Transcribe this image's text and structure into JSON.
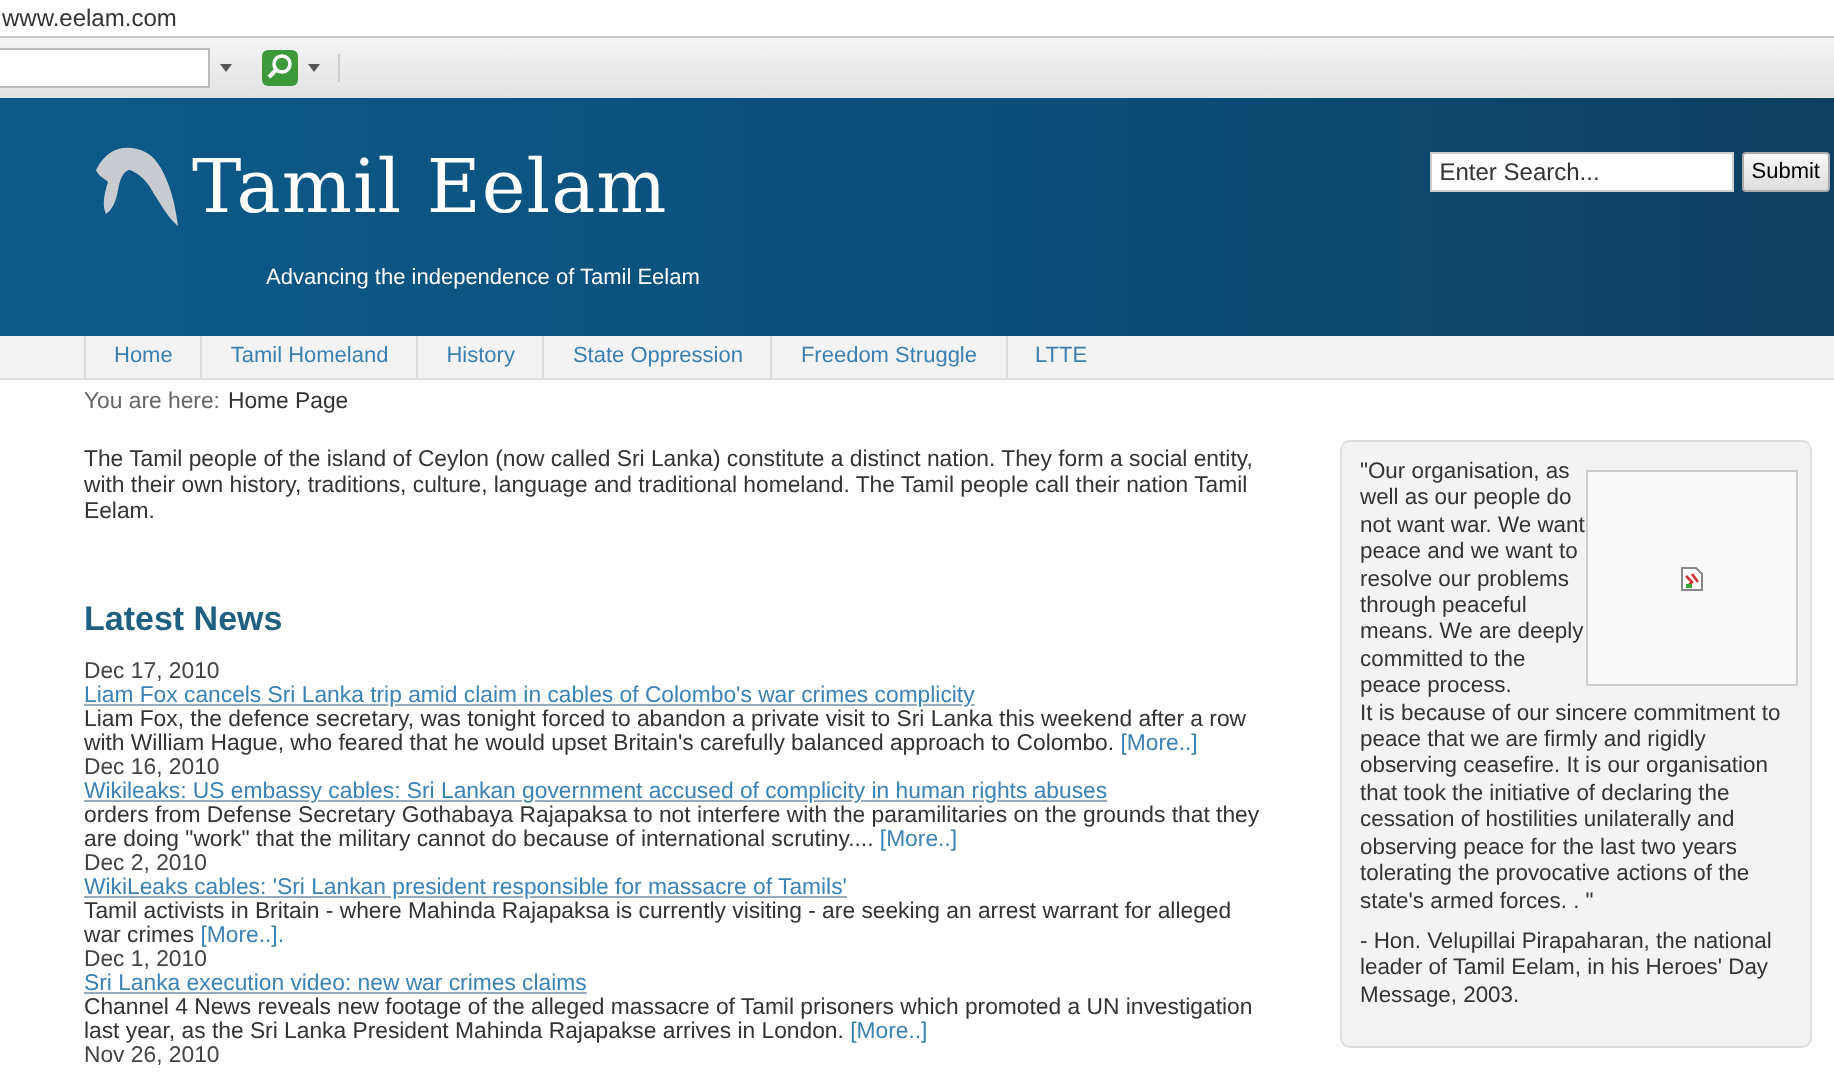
{
  "address": "www.eelam.com",
  "header": {
    "title": "Tamil Eelam",
    "tagline": "Advancing the independence of Tamil Eelam",
    "search": {
      "placeholder": "Enter Search..."
    },
    "submit": "Submit"
  },
  "nav": [
    {
      "label": "Home"
    },
    {
      "label": "Tamil Homeland"
    },
    {
      "label": "History"
    },
    {
      "label": "State Oppression"
    },
    {
      "label": "Freedom Struggle"
    },
    {
      "label": "LTTE"
    }
  ],
  "breadcrumb": {
    "label": "You are here:",
    "page": "Home Page"
  },
  "intro": "The Tamil people of the island of Ceylon (now called Sri Lanka) constitute a distinct nation. They form a social entity, with their own history, traditions, culture, language and traditional homeland. The Tamil people call their nation Tamil Eelam.",
  "latest_news": {
    "heading": "Latest News",
    "items": [
      {
        "date": "Dec 17, 2010",
        "title": "Liam Fox cancels Sri Lanka trip amid claim in cables of Colombo's war crimes complicity",
        "summary": "Liam Fox, the defence secretary, was tonight forced to abandon a private visit to Sri Lanka this weekend after a row with William Hague, who feared that he would upset Britain's carefully balanced approach to Colombo. ",
        "more": "[More..]"
      },
      {
        "date": "Dec 16, 2010",
        "title": "Wikileaks: US embassy cables: Sri Lankan government accused of complicity in human rights abuses",
        "summary": "orders from Defense Secretary Gothabaya Rajapaksa to not interfere with the paramilitaries on the grounds that they are doing \"work\" that the military cannot do because of international scrutiny.... ",
        "more": "[More..]"
      },
      {
        "date": "Dec 2, 2010",
        "title": "WikiLeaks cables: 'Sri Lankan president responsible for massacre of Tamils'",
        "summary": "Tamil activists in Britain - where Mahinda Rajapaksa is currently visiting - are seeking an arrest warrant for alleged war crimes ",
        "more": "[More..]."
      },
      {
        "date": "Dec 1, 2010",
        "title": "Sri Lanka execution video: new war crimes claims",
        "summary": "Channel 4 News reveals new footage of the alleged massacre of Tamil prisoners which promoted a UN investigation last year, as the Sri Lanka President Mahinda Rajapakse arrives in London. ",
        "more": "[More..]"
      },
      {
        "date": "Nov 26, 2010"
      }
    ]
  },
  "quote": {
    "opening": "\"Our organisation, as well as our people do not want war. We want peace and we want to resolve our problems through peaceful means. We are deeply committed to the peace process.",
    "text": "It is because of our sincere commitment to peace that we are firmly and rigidly observing ceasefire. It is our organisation that took the initiative of declaring the cessation of hostilities unilaterally and observing peace for the last two years tolerating the provocative actions of the state's armed forces. . \"",
    "attribution": "- Hon. Velupillai Pirapaharan, the national leader of Tamil Eelam, in his Heroes' Day Message, 2003."
  }
}
